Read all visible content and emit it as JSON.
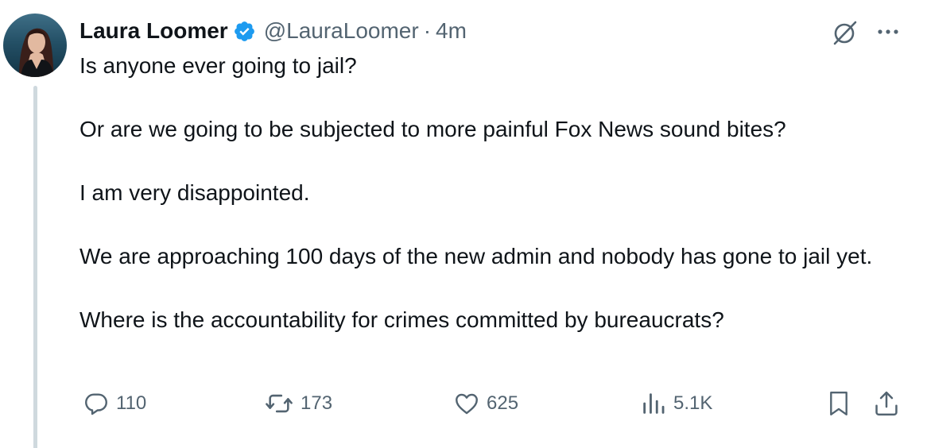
{
  "user": {
    "name": "Laura Loomer",
    "handle": "@LauraLoomer",
    "separator": "·",
    "time": "4m",
    "verified": true,
    "verified_color": "#1d9bf0"
  },
  "tweet": {
    "paragraphs": [
      "Is anyone ever going to jail?",
      "Or are we going to be subjected to more painful Fox News sound bites?",
      "I am very disappointed.",
      "We are approaching 100 days of the new admin and nobody has gone to jail yet.",
      "Where is the accountability for crimes committed by bureaucrats?"
    ]
  },
  "actions": {
    "replies": "110",
    "reposts": "173",
    "likes": "625",
    "views": "5.1K"
  },
  "icons": {
    "header": [
      "grok-icon",
      "more-icon"
    ],
    "actions": [
      "reply-icon",
      "repost-icon",
      "like-icon",
      "views-icon",
      "bookmark-icon",
      "share-icon"
    ]
  },
  "colors": {
    "text": "#0f1419",
    "secondary": "#536471",
    "thread_line": "#cfd9de"
  }
}
